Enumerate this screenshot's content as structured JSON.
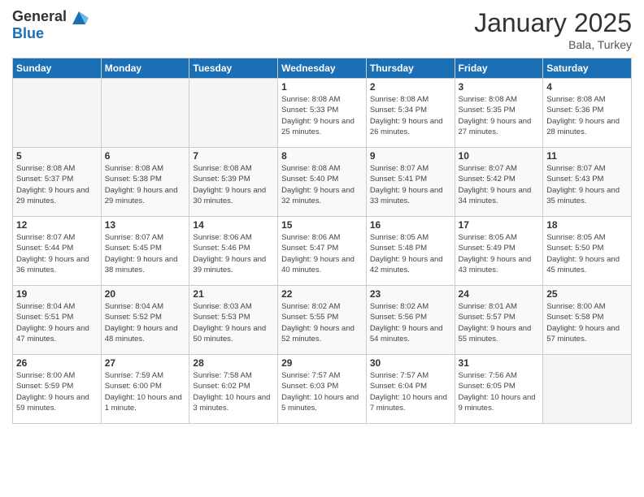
{
  "header": {
    "logo_general": "General",
    "logo_blue": "Blue",
    "month": "January 2025",
    "location": "Bala, Turkey"
  },
  "days_of_week": [
    "Sunday",
    "Monday",
    "Tuesday",
    "Wednesday",
    "Thursday",
    "Friday",
    "Saturday"
  ],
  "weeks": [
    [
      {
        "day": "",
        "empty": true
      },
      {
        "day": "",
        "empty": true
      },
      {
        "day": "",
        "empty": true
      },
      {
        "day": "1",
        "sunrise": "8:08 AM",
        "sunset": "5:33 PM",
        "daylight": "9 hours and 25 minutes."
      },
      {
        "day": "2",
        "sunrise": "8:08 AM",
        "sunset": "5:34 PM",
        "daylight": "9 hours and 26 minutes."
      },
      {
        "day": "3",
        "sunrise": "8:08 AM",
        "sunset": "5:35 PM",
        "daylight": "9 hours and 27 minutes."
      },
      {
        "day": "4",
        "sunrise": "8:08 AM",
        "sunset": "5:36 PM",
        "daylight": "9 hours and 28 minutes."
      }
    ],
    [
      {
        "day": "5",
        "sunrise": "8:08 AM",
        "sunset": "5:37 PM",
        "daylight": "9 hours and 29 minutes."
      },
      {
        "day": "6",
        "sunrise": "8:08 AM",
        "sunset": "5:38 PM",
        "daylight": "9 hours and 29 minutes."
      },
      {
        "day": "7",
        "sunrise": "8:08 AM",
        "sunset": "5:39 PM",
        "daylight": "9 hours and 30 minutes."
      },
      {
        "day": "8",
        "sunrise": "8:08 AM",
        "sunset": "5:40 PM",
        "daylight": "9 hours and 32 minutes."
      },
      {
        "day": "9",
        "sunrise": "8:07 AM",
        "sunset": "5:41 PM",
        "daylight": "9 hours and 33 minutes."
      },
      {
        "day": "10",
        "sunrise": "8:07 AM",
        "sunset": "5:42 PM",
        "daylight": "9 hours and 34 minutes."
      },
      {
        "day": "11",
        "sunrise": "8:07 AM",
        "sunset": "5:43 PM",
        "daylight": "9 hours and 35 minutes."
      }
    ],
    [
      {
        "day": "12",
        "sunrise": "8:07 AM",
        "sunset": "5:44 PM",
        "daylight": "9 hours and 36 minutes."
      },
      {
        "day": "13",
        "sunrise": "8:07 AM",
        "sunset": "5:45 PM",
        "daylight": "9 hours and 38 minutes."
      },
      {
        "day": "14",
        "sunrise": "8:06 AM",
        "sunset": "5:46 PM",
        "daylight": "9 hours and 39 minutes."
      },
      {
        "day": "15",
        "sunrise": "8:06 AM",
        "sunset": "5:47 PM",
        "daylight": "9 hours and 40 minutes."
      },
      {
        "day": "16",
        "sunrise": "8:05 AM",
        "sunset": "5:48 PM",
        "daylight": "9 hours and 42 minutes."
      },
      {
        "day": "17",
        "sunrise": "8:05 AM",
        "sunset": "5:49 PM",
        "daylight": "9 hours and 43 minutes."
      },
      {
        "day": "18",
        "sunrise": "8:05 AM",
        "sunset": "5:50 PM",
        "daylight": "9 hours and 45 minutes."
      }
    ],
    [
      {
        "day": "19",
        "sunrise": "8:04 AM",
        "sunset": "5:51 PM",
        "daylight": "9 hours and 47 minutes."
      },
      {
        "day": "20",
        "sunrise": "8:04 AM",
        "sunset": "5:52 PM",
        "daylight": "9 hours and 48 minutes."
      },
      {
        "day": "21",
        "sunrise": "8:03 AM",
        "sunset": "5:53 PM",
        "daylight": "9 hours and 50 minutes."
      },
      {
        "day": "22",
        "sunrise": "8:02 AM",
        "sunset": "5:55 PM",
        "daylight": "9 hours and 52 minutes."
      },
      {
        "day": "23",
        "sunrise": "8:02 AM",
        "sunset": "5:56 PM",
        "daylight": "9 hours and 54 minutes."
      },
      {
        "day": "24",
        "sunrise": "8:01 AM",
        "sunset": "5:57 PM",
        "daylight": "9 hours and 55 minutes."
      },
      {
        "day": "25",
        "sunrise": "8:00 AM",
        "sunset": "5:58 PM",
        "daylight": "9 hours and 57 minutes."
      }
    ],
    [
      {
        "day": "26",
        "sunrise": "8:00 AM",
        "sunset": "5:59 PM",
        "daylight": "9 hours and 59 minutes."
      },
      {
        "day": "27",
        "sunrise": "7:59 AM",
        "sunset": "6:00 PM",
        "daylight": "10 hours and 1 minute."
      },
      {
        "day": "28",
        "sunrise": "7:58 AM",
        "sunset": "6:02 PM",
        "daylight": "10 hours and 3 minutes."
      },
      {
        "day": "29",
        "sunrise": "7:57 AM",
        "sunset": "6:03 PM",
        "daylight": "10 hours and 5 minutes."
      },
      {
        "day": "30",
        "sunrise": "7:57 AM",
        "sunset": "6:04 PM",
        "daylight": "10 hours and 7 minutes."
      },
      {
        "day": "31",
        "sunrise": "7:56 AM",
        "sunset": "6:05 PM",
        "daylight": "10 hours and 9 minutes."
      },
      {
        "day": "",
        "empty": true
      }
    ]
  ]
}
